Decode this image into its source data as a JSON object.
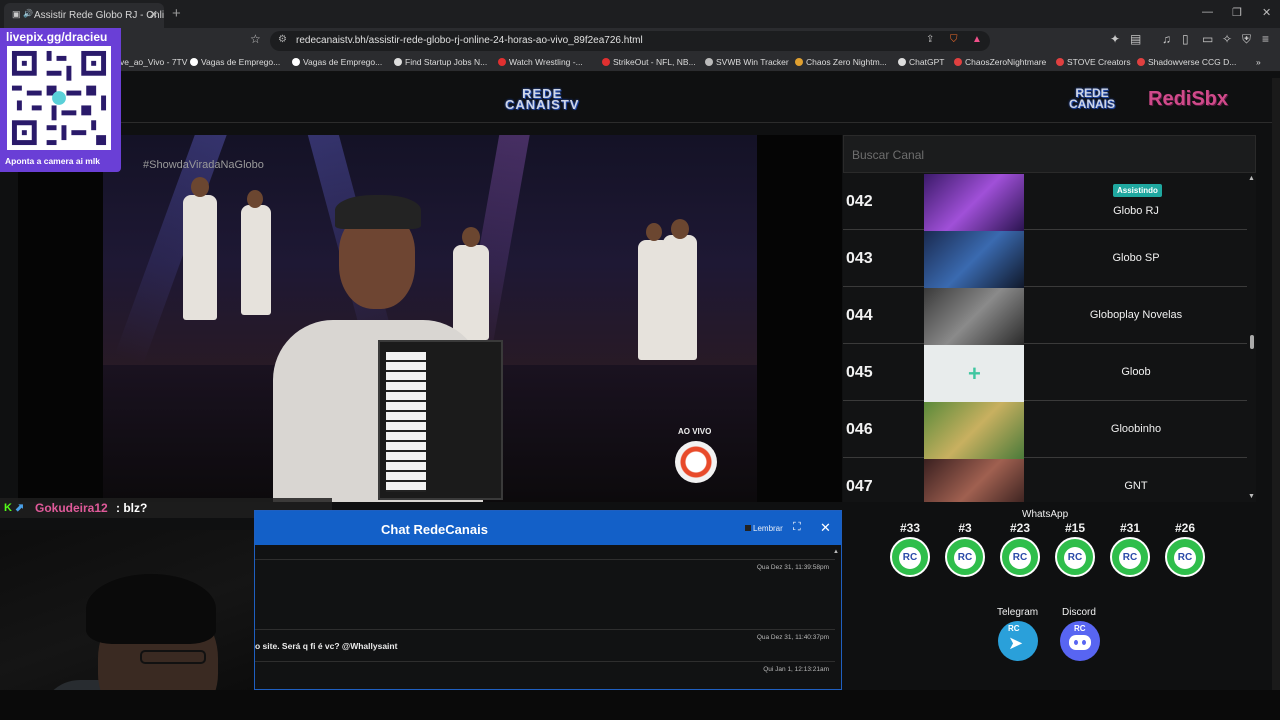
{
  "browser": {
    "tab_title": "Assistir Rede Globo RJ - Onli",
    "url": "redecanaistv.bh/assistir-rede-globo-rj-online-24-horas-ao-vivo_89f2ea726.html",
    "bookmarks": [
      {
        "label": "ve_ao_Vivo - 7TV",
        "color": "#888888"
      },
      {
        "label": "Vagas de Emprego...",
        "color": "#ffffff"
      },
      {
        "label": "Vagas de Emprego...",
        "color": "#ffffff"
      },
      {
        "label": "Find Startup Jobs N...",
        "color": "#dddddd"
      },
      {
        "label": "Watch Wrestling -...",
        "color": "#e03030"
      },
      {
        "label": "StrikeOut - NFL, NB...",
        "color": "#e03030"
      },
      {
        "label": "SVWB Win Tracker",
        "color": "#bbbbbb"
      },
      {
        "label": "Chaos Zero Nightm...",
        "color": "#e0a030"
      },
      {
        "label": "ChatGPT",
        "color": "#dddddd"
      },
      {
        "label": "ChaosZeroNightmare",
        "color": "#e04040"
      },
      {
        "label": "STOVE Creators",
        "color": "#e04040"
      },
      {
        "label": "Shadowverse CCG D...",
        "color": "#e04040"
      }
    ]
  },
  "overlay": {
    "qr_title": "livepix.gg/dracieu",
    "qr_caption": "Aponta a camera ai mlk",
    "chat_user": "Gokudeira12",
    "chat_message": ": blz?"
  },
  "site": {
    "logo_center": "REDE\nCANAISTV",
    "logo_right1": "REDE\nCANAIS",
    "logo_right2": "RediSbx"
  },
  "video": {
    "hashtag": "#ShowdaViradaNaGlobo",
    "live_label": "AO VIVO"
  },
  "channels": {
    "search_placeholder": "Buscar Canal",
    "watching_badge": "Assistindo",
    "items": [
      {
        "number": "042",
        "name": "Globo RJ",
        "watching": true
      },
      {
        "number": "043",
        "name": "Globo SP",
        "watching": false
      },
      {
        "number": "044",
        "name": "Globoplay Novelas",
        "watching": false
      },
      {
        "number": "045",
        "name": "Gloob",
        "watching": false
      },
      {
        "number": "046",
        "name": "Gloobinho",
        "watching": false
      },
      {
        "number": "047",
        "name": "GNT",
        "watching": false
      }
    ]
  },
  "chat": {
    "title": "Chat RedeCanais",
    "remember_label": "Lembrar",
    "messages": [
      {
        "time": "Qua Dez 31, 11:39:58pm",
        "text": ""
      },
      {
        "time": "Qua Dez 31, 11:40:37pm",
        "text": "o site. Será q fi é vc? @Whallysaint"
      },
      {
        "time": "Qui Jan 1, 12:13:21am",
        "text": ""
      }
    ]
  },
  "social": {
    "whatsapp_title": "WhatsApp",
    "whatsapp_groups": [
      "#33",
      "#3",
      "#23",
      "#15",
      "#31",
      "#26"
    ],
    "telegram_label": "Telegram",
    "discord_label": "Discord",
    "icon_text": "RC"
  }
}
